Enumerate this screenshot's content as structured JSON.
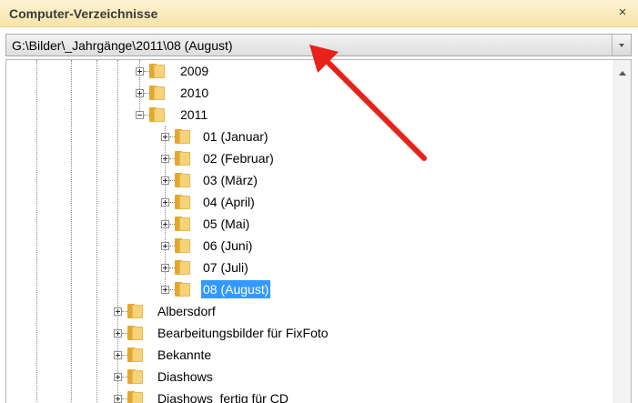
{
  "panel": {
    "title": "Computer-Verzeichnisse",
    "close_symbol": "×",
    "path": "G:\\Bilder\\_Jahrgänge\\2011\\08 (August)"
  },
  "tree": {
    "years": [
      {
        "label": "2009",
        "expanded": false
      },
      {
        "label": "2010",
        "expanded": false
      },
      {
        "label": "2011",
        "expanded": true
      }
    ],
    "months": [
      {
        "label": "01 (Januar)"
      },
      {
        "label": "02 (Februar)"
      },
      {
        "label": "03 (März)"
      },
      {
        "label": "04 (April)"
      },
      {
        "label": "05 (Mai)"
      },
      {
        "label": "06 (Juni)"
      },
      {
        "label": "07 (Juli)"
      },
      {
        "label": "08 (August)",
        "selected": true
      }
    ],
    "siblings": [
      {
        "label": "Albersdorf"
      },
      {
        "label": "Bearbeitungsbilder für FixFoto"
      },
      {
        "label": "Bekannte"
      },
      {
        "label": "Diashows"
      },
      {
        "label": "Diashows_fertig für CD"
      }
    ]
  },
  "annotation": {
    "arrow_color": "#e8221b"
  },
  "icons": {
    "folder": "folder-icon",
    "close": "close-icon",
    "dropdown": "chevron-down-icon",
    "expander": "plus-minus-icon"
  },
  "colors": {
    "selection": "#3399ff",
    "titlebar": "#f7e4a8",
    "folder": "#f6d27a"
  }
}
